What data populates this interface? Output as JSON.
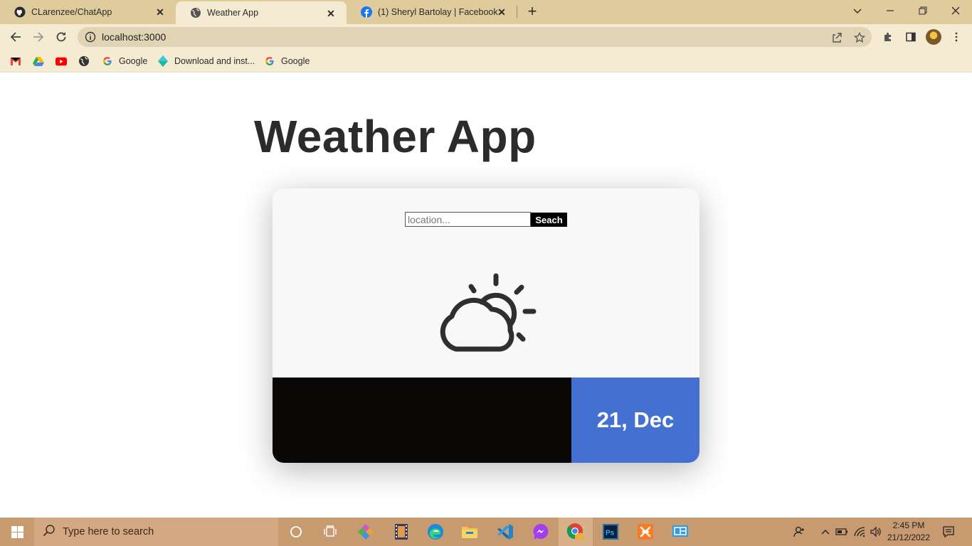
{
  "browser": {
    "tabs": [
      {
        "title": "CLarenzee/ChatApp",
        "icon": "github-icon",
        "active": false
      },
      {
        "title": "Weather App",
        "icon": "globe-icon",
        "active": true
      },
      {
        "title": "(1) Sheryl Bartolay | Facebook",
        "icon": "facebook-icon",
        "active": false
      }
    ],
    "url": "localhost:3000",
    "bookmarks": [
      {
        "label": "",
        "icon": "gmail-icon"
      },
      {
        "label": "",
        "icon": "drive-icon"
      },
      {
        "label": "",
        "icon": "youtube-icon"
      },
      {
        "label": "",
        "icon": "globe-icon"
      },
      {
        "label": "Google",
        "icon": "google-icon"
      },
      {
        "label": "Download and inst...",
        "icon": "diamond-icon"
      },
      {
        "label": "Google",
        "icon": "google-icon"
      }
    ]
  },
  "app": {
    "title": "Weather App",
    "search": {
      "placeholder": "location...",
      "value": "",
      "button_label": "Seach"
    },
    "weather_icon": "partly-cloudy-icon",
    "date": "21, Dec",
    "colors": {
      "date_panel": "#4470d2",
      "bottom_panel": "#080706",
      "card_bg": "#f8f8f8"
    }
  },
  "taskbar": {
    "search_placeholder": "Type here to search",
    "time": "2:45 PM",
    "date": "21/12/2022"
  }
}
